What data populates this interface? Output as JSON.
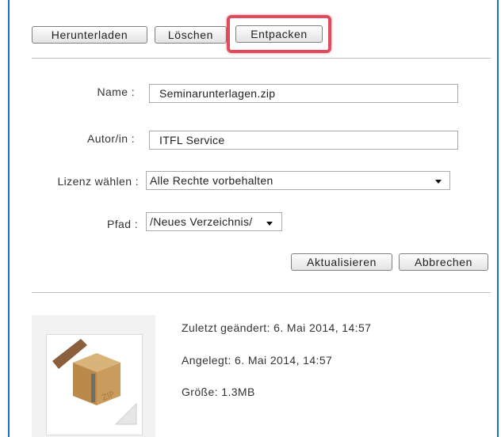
{
  "toolbar": {
    "download_label": "Herunterladen",
    "delete_label": "Löschen",
    "unpack_label": "Entpacken"
  },
  "form": {
    "name_label": "Name :",
    "name_value": "Seminarunterlagen.zip",
    "author_label": "Autor/in :",
    "author_value": "ITFL Service",
    "license_label": "Lizenz wählen :",
    "license_value": "Alle Rechte vorbehalten",
    "path_label": "Pfad :",
    "path_value": "/Neues Verzeichnis/"
  },
  "actions": {
    "update_label": "Aktualisieren",
    "cancel_label": "Abbrechen"
  },
  "file_info": {
    "modified": "Zuletzt geändert: 6. Mai 2014, 14:57",
    "created": "Angelegt: 6. Mai 2014, 14:57",
    "size": "Größe: 1.3MB"
  },
  "thumbnail": {
    "icon": "zip-archive-icon",
    "badge": "ZIP"
  },
  "colors": {
    "highlight": "#e04a5a",
    "frame": "#1e6fb6"
  }
}
